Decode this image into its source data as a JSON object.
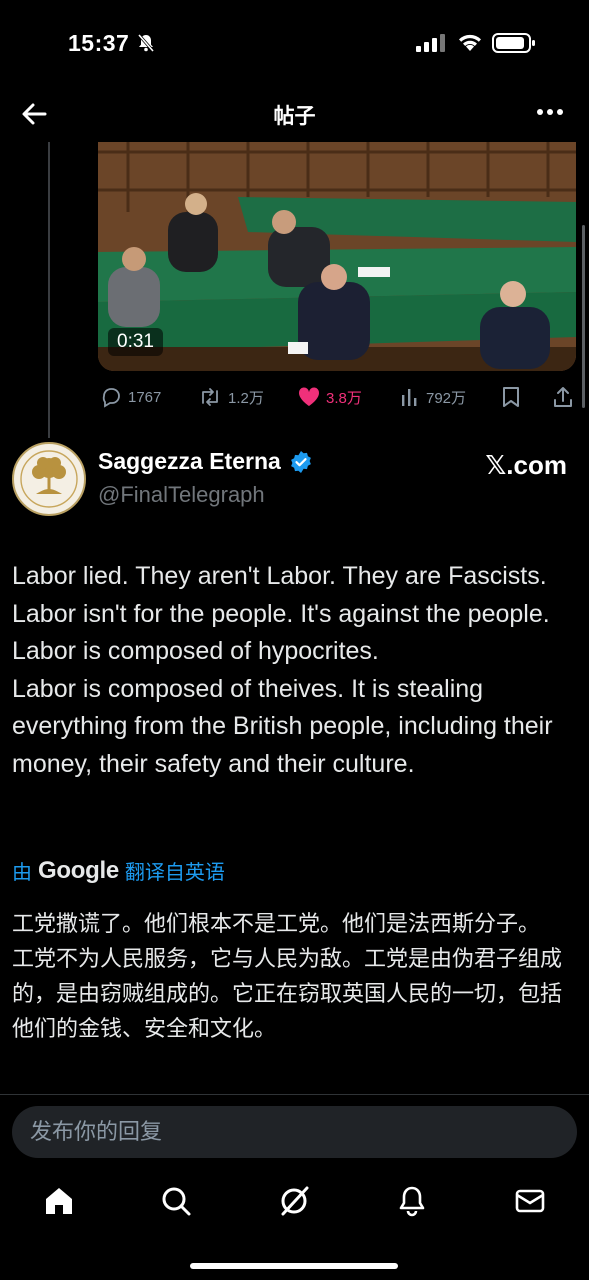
{
  "status_bar": {
    "time": "15:37"
  },
  "header": {
    "title": "帖子"
  },
  "video": {
    "duration": "0:31"
  },
  "actions": {
    "replies": "1767",
    "reposts": "1.2万",
    "likes": "3.8万",
    "views": "792万"
  },
  "post": {
    "display_name": "Saggezza Eterna",
    "handle": "@FinalTelegraph",
    "source_label": "𝕏.com",
    "text_lines": [
      "Labor lied.  They aren't Labor.  They are Fascists.",
      "Labor isn't for the people.  It's against the people.  Labor is composed of hypocrites.",
      "Labor is composed of theives.  It is stealing everything from the British people, including their money, their safety and their culture."
    ],
    "translation": {
      "prefix": "由",
      "provider": "Google",
      "suffix": "翻译自英语",
      "lines": [
        "工党撒谎了。他们根本不是工党。他们是法西斯分子。",
        "工党不为人民服务，它与人民为敌。工党是由伪君子组成的，是由窃贼组成的。它正在窃取英国人民的一切，包括他们的金钱、安全和文化。"
      ]
    }
  },
  "reply": {
    "placeholder": "发布你的回复"
  },
  "colors": {
    "accent": "#1d9bf0",
    "like": "#f0307a",
    "background": "#000000"
  },
  "nav": [
    "home-icon",
    "search-icon",
    "grok-icon",
    "notifications-icon",
    "messages-icon"
  ]
}
